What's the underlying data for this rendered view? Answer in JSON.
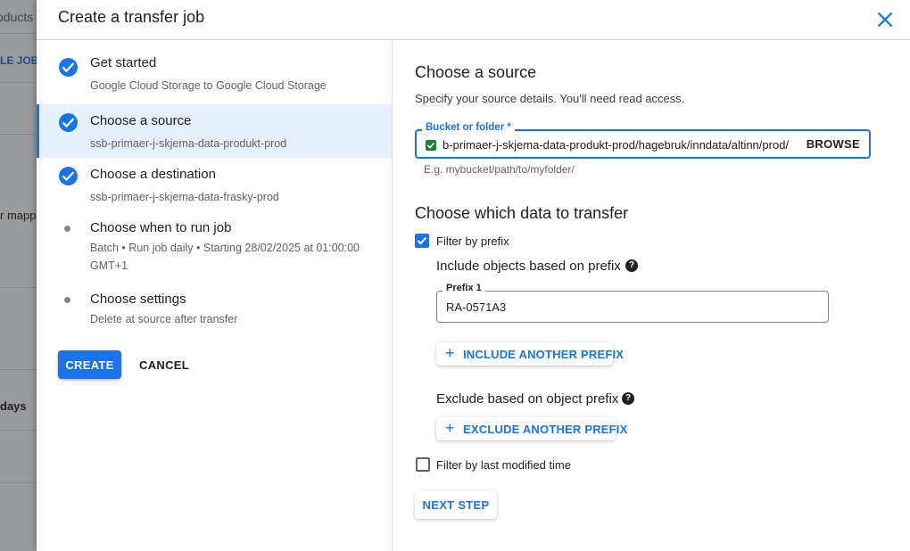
{
  "background": {
    "search_text": "oducts",
    "link_text": "LE JOB",
    "row_text_1": "r mappe",
    "row_text_2": "days"
  },
  "dialog": {
    "title": "Create a transfer job",
    "close_icon": "close-icon"
  },
  "stepper": {
    "steps": [
      {
        "title": "Get started",
        "subtitle": "Google Cloud Storage to Google Cloud Storage",
        "state": "done"
      },
      {
        "title": "Choose a source",
        "subtitle": "ssb-primaer-j-skjema-data-produkt-prod",
        "state": "done-active"
      },
      {
        "title": "Choose a destination",
        "subtitle": "ssb-primaer-j-skjema-data-frasky-prod",
        "state": "done"
      },
      {
        "title": "Choose when to run job",
        "subtitle": "Batch • Run job daily • Starting 28/02/2025 at 01:00:00 GMT+1",
        "state": "pending"
      },
      {
        "title": "Choose settings",
        "subtitle": "Delete at source after transfer",
        "state": "pending"
      }
    ],
    "create_label": "CREATE",
    "cancel_label": "CANCEL"
  },
  "source": {
    "heading": "Choose a source",
    "description": "Specify your source details. You'll need read access.",
    "bucket_label": "Bucket or folder *",
    "bucket_value": "b-primaer-j-skjema-data-produkt-prod/hagebruk/inndata/altinn/prod/",
    "browse_label": "BROWSE",
    "hint": "E.g. mybucket/path/to/myfolder/"
  },
  "transfer": {
    "heading": "Choose which data to transfer",
    "filter_prefix_label": "Filter by prefix",
    "filter_prefix_checked": true,
    "include_heading": "Include objects based on prefix",
    "prefix_label": "Prefix 1",
    "prefix_value": "RA-0571A3",
    "include_another_label": "INCLUDE ANOTHER PREFIX",
    "exclude_heading": "Exclude based on object prefix",
    "exclude_another_label": "EXCLUDE ANOTHER PREFIX",
    "filter_modified_label": "Filter by last modified time",
    "filter_modified_checked": false,
    "next_label": "NEXT STEP"
  },
  "colors": {
    "accent": "#1a73e8",
    "success": "#188038",
    "text": "#202124",
    "secondary_text": "#5f6368"
  }
}
